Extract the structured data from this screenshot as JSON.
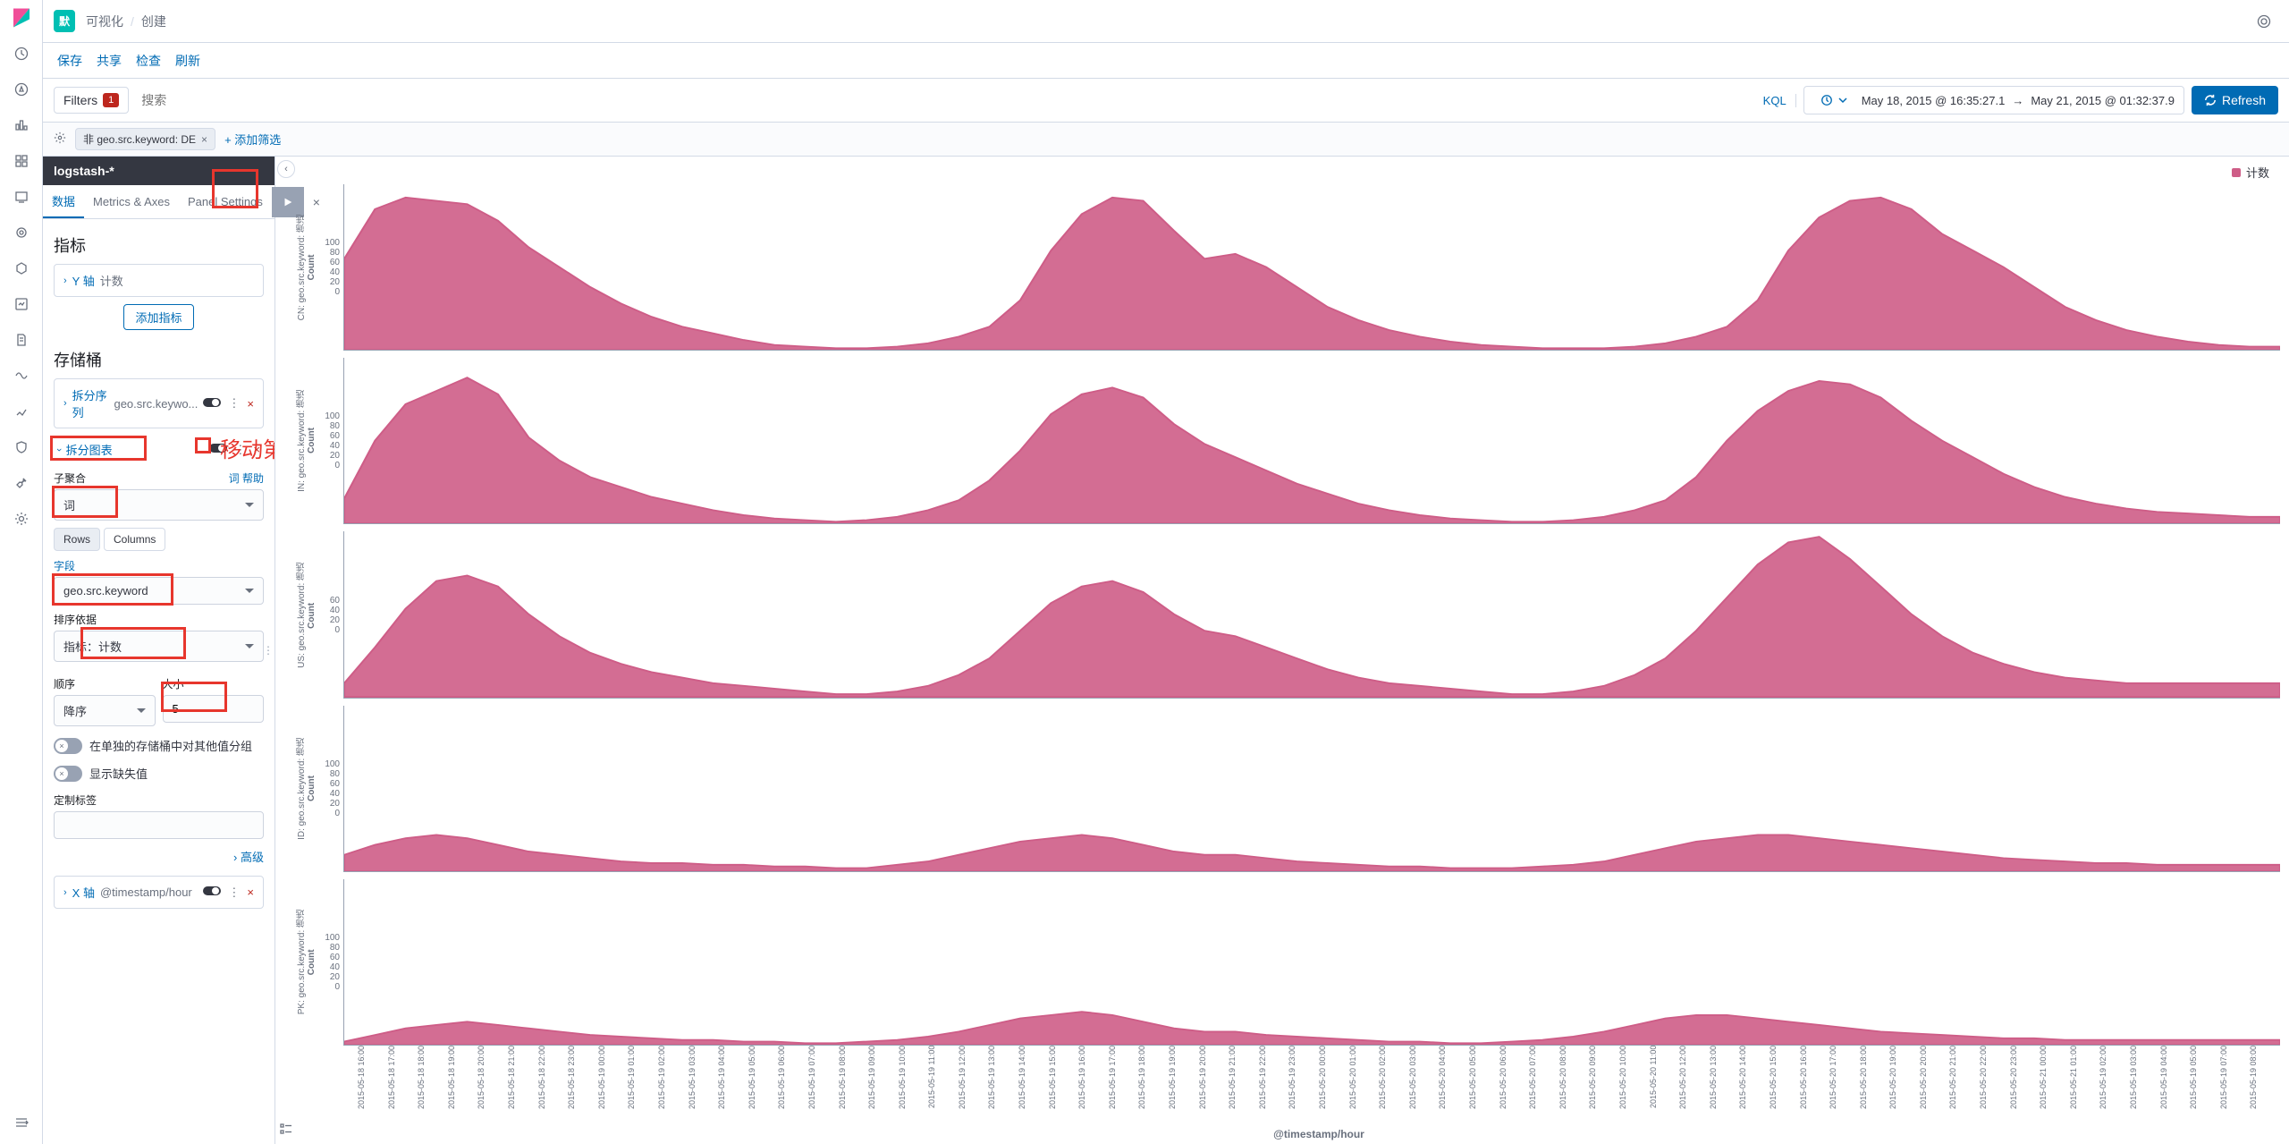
{
  "header": {
    "tag": "默",
    "breadcrumb": [
      "可视化",
      "创建"
    ]
  },
  "toolbar": {
    "save": "保存",
    "share": "共享",
    "inspect": "检查",
    "refresh": "刷新"
  },
  "query": {
    "filters_label": "Filters",
    "filters_count": "1",
    "search_placeholder": "搜索",
    "kql": "KQL",
    "date_from": "May 18, 2015 @ 16:35:27.1",
    "date_to": "May 21, 2015 @ 01:32:37.9",
    "refresh_btn": "Refresh"
  },
  "filter_pill": {
    "text": "非 geo.src.keyword: DE",
    "add": "+ 添加筛选"
  },
  "panel": {
    "index": "logstash-*",
    "tabs": {
      "data": "数据",
      "metrics": "Metrics & Axes",
      "settings": "Panel Settings"
    },
    "metrics_title": "指标",
    "y_axis": {
      "label": "Y 轴",
      "value": "计数"
    },
    "add_metric": "添加指标",
    "buckets_title": "存储桶",
    "split_series": {
      "label": "拆分序列",
      "value": "geo.src.keywo..."
    },
    "split_chart": {
      "label": "拆分图表"
    },
    "sub_agg_label": "子聚合",
    "sub_agg_help_term": "词",
    "sub_agg_help": "帮助",
    "sub_agg_value": "词",
    "rows_label": "Rows",
    "cols_label": "Columns",
    "field_label": "字段",
    "field_value": "geo.src.keyword",
    "order_by_label": "排序依据",
    "order_by_value": "指标：计数",
    "order_label": "顺序",
    "order_value": "降序",
    "size_label": "大小",
    "size_value": "5",
    "group_other": "在单独的存储桶中对其他值分组",
    "show_missing": "显示缺失值",
    "custom_label": "定制标签",
    "advanced": "› 高级",
    "x_axis": {
      "label": "X 轴",
      "value": "@timestamp/hour"
    }
  },
  "annotation": "移动第二行",
  "legend": "计数",
  "xaxis_title": "@timestamp/hour",
  "chart_data": {
    "type": "area",
    "xlabel": "@timestamp/hour",
    "ylabel": "Count",
    "series_name": "计数",
    "color": "#CE5D87",
    "panels": [
      {
        "facet": "CN: geo.src.keyword: 筛选",
        "ymax": 100,
        "yticks": [
          100,
          80,
          60,
          40,
          20,
          0
        ],
        "values": [
          55,
          85,
          92,
          90,
          88,
          78,
          62,
          50,
          38,
          28,
          20,
          14,
          10,
          6,
          3,
          2,
          1,
          1,
          2,
          4,
          8,
          14,
          30,
          60,
          82,
          92,
          90,
          72,
          55,
          58,
          50,
          38,
          26,
          18,
          12,
          8,
          5,
          3,
          2,
          1,
          1,
          1,
          2,
          4,
          8,
          14,
          30,
          60,
          80,
          90,
          92,
          85,
          70,
          60,
          50,
          38,
          26,
          18,
          12,
          8,
          5,
          3,
          2,
          2
        ]
      },
      {
        "facet": "IN: geo.src.keyword: 筛选",
        "ymax": 100,
        "yticks": [
          100,
          80,
          60,
          40,
          20,
          0
        ],
        "values": [
          15,
          50,
          72,
          80,
          88,
          78,
          52,
          38,
          28,
          22,
          16,
          12,
          8,
          5,
          3,
          2,
          1,
          2,
          4,
          8,
          14,
          26,
          44,
          66,
          78,
          82,
          76,
          60,
          48,
          40,
          32,
          24,
          18,
          12,
          8,
          5,
          3,
          2,
          1,
          1,
          2,
          4,
          8,
          14,
          28,
          50,
          68,
          80,
          86,
          84,
          76,
          62,
          50,
          40,
          30,
          22,
          16,
          12,
          9,
          7,
          6,
          5,
          4,
          4
        ]
      },
      {
        "facet": "US: geo.src.keyword: 筛选",
        "ymax": 60,
        "yticks": [
          60,
          40,
          20,
          0
        ],
        "values": [
          5,
          18,
          32,
          42,
          44,
          40,
          30,
          22,
          16,
          12,
          9,
          7,
          5,
          4,
          3,
          2,
          1,
          1,
          2,
          4,
          8,
          14,
          24,
          34,
          40,
          42,
          38,
          30,
          24,
          22,
          18,
          14,
          10,
          7,
          5,
          4,
          3,
          2,
          1,
          1,
          2,
          4,
          8,
          14,
          24,
          36,
          48,
          56,
          58,
          50,
          40,
          30,
          22,
          16,
          12,
          9,
          7,
          6,
          5,
          5,
          5,
          5,
          5,
          5
        ]
      },
      {
        "facet": "ID: geo.src.keyword: 筛选",
        "ymax": 100,
        "yticks": [
          100,
          80,
          60,
          40,
          20,
          0
        ],
        "values": [
          10,
          16,
          20,
          22,
          20,
          16,
          12,
          10,
          8,
          6,
          5,
          5,
          4,
          4,
          3,
          3,
          2,
          2,
          4,
          6,
          10,
          14,
          18,
          20,
          22,
          20,
          16,
          12,
          10,
          10,
          8,
          6,
          5,
          4,
          3,
          3,
          2,
          2,
          2,
          3,
          4,
          6,
          10,
          14,
          18,
          20,
          22,
          22,
          20,
          18,
          16,
          14,
          12,
          10,
          8,
          7,
          6,
          5,
          5,
          4,
          4,
          4,
          4,
          4
        ]
      },
      {
        "facet": "PK: geo.src.keyword: 筛选",
        "ymax": 100,
        "yticks": [
          100,
          80,
          60,
          40,
          20,
          0
        ],
        "values": [
          2,
          6,
          10,
          12,
          14,
          12,
          10,
          8,
          6,
          5,
          4,
          3,
          3,
          2,
          2,
          1,
          1,
          2,
          3,
          5,
          8,
          12,
          16,
          18,
          20,
          18,
          14,
          10,
          8,
          8,
          6,
          5,
          4,
          3,
          2,
          2,
          1,
          1,
          2,
          3,
          5,
          8,
          12,
          16,
          18,
          18,
          16,
          14,
          12,
          10,
          8,
          7,
          6,
          5,
          4,
          4,
          3,
          3,
          3,
          3,
          3,
          3,
          3,
          3
        ]
      }
    ],
    "x_categories": [
      "2015-05-18 16:00",
      "2015-05-18 17:00",
      "2015-05-18 18:00",
      "2015-05-18 19:00",
      "2015-05-18 20:00",
      "2015-05-18 21:00",
      "2015-05-18 22:00",
      "2015-05-18 23:00",
      "2015-05-19 00:00",
      "2015-05-19 01:00",
      "2015-05-19 02:00",
      "2015-05-19 03:00",
      "2015-05-19 04:00",
      "2015-05-19 05:00",
      "2015-05-19 06:00",
      "2015-05-19 07:00",
      "2015-05-19 08:00",
      "2015-05-19 09:00",
      "2015-05-19 10:00",
      "2015-05-19 11:00",
      "2015-05-19 12:00",
      "2015-05-19 13:00",
      "2015-05-19 14:00",
      "2015-05-19 15:00",
      "2015-05-19 16:00",
      "2015-05-19 17:00",
      "2015-05-19 18:00",
      "2015-05-19 19:00",
      "2015-05-19 20:00",
      "2015-05-19 21:00",
      "2015-05-19 22:00",
      "2015-05-19 23:00",
      "2015-05-20 00:00",
      "2015-05-20 01:00",
      "2015-05-20 02:00",
      "2015-05-20 03:00",
      "2015-05-20 04:00",
      "2015-05-20 05:00",
      "2015-05-20 06:00",
      "2015-05-20 07:00",
      "2015-05-20 08:00",
      "2015-05-20 09:00",
      "2015-05-20 10:00",
      "2015-05-20 11:00",
      "2015-05-20 12:00",
      "2015-05-20 13:00",
      "2015-05-20 14:00",
      "2015-05-20 15:00",
      "2015-05-20 16:00",
      "2015-05-20 17:00",
      "2015-05-20 18:00",
      "2015-05-20 19:00",
      "2015-05-20 20:00",
      "2015-05-20 21:00",
      "2015-05-20 22:00",
      "2015-05-20 23:00",
      "2015-05-21 00:00",
      "2015-05-21 01:00",
      "2015-05-19 02:00",
      "2015-05-19 03:00",
      "2015-05-19 04:00",
      "2015-05-19 05:00",
      "2015-05-19 07:00",
      "2015-05-19 08:00"
    ]
  }
}
